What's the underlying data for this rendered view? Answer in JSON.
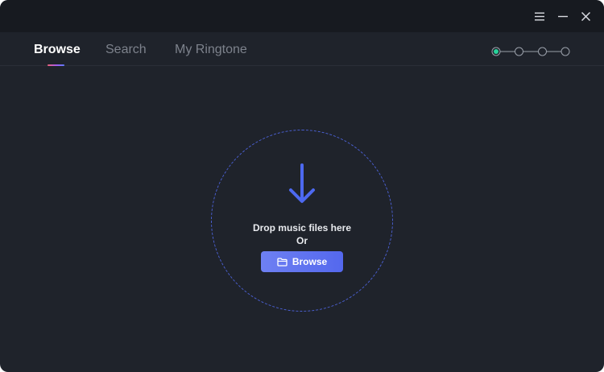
{
  "titlebar": {
    "icons": [
      "menu-icon",
      "minimize-icon",
      "close-icon"
    ]
  },
  "tabs": [
    {
      "label": "Browse",
      "active": true
    },
    {
      "label": "Search",
      "active": false
    },
    {
      "label": "My Ringtone",
      "active": false
    }
  ],
  "steps": {
    "total": 4,
    "current": 1,
    "active_color": "#28d39a"
  },
  "drop_zone": {
    "icon": "download-arrow-icon",
    "text": "Drop music files here",
    "or_text": "Or",
    "button_label": "Browse",
    "button_icon": "folder-icon"
  },
  "colors": {
    "background": "#1f232b",
    "titlebar": "#171a20",
    "accent": "#5b6ff0",
    "dashed_border": "#4a5fd0"
  }
}
